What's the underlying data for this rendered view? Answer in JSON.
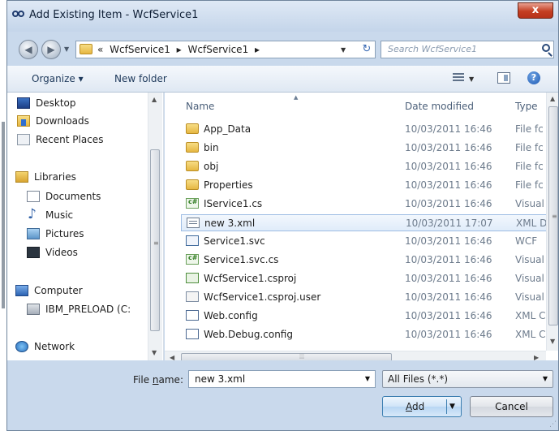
{
  "window": {
    "title": "Add Existing Item - WcfService1",
    "close_label": "x"
  },
  "address_bar": {
    "prefix": "«",
    "crumbs": [
      "WcfService1",
      "WcfService1"
    ],
    "separator": "▸",
    "search_placeholder": "Search WcfService1"
  },
  "toolbar": {
    "organize_label": "Organize ▾",
    "new_folder_label": "New folder",
    "help_label": "?"
  },
  "nav_pane": {
    "favorites": [
      {
        "label": "Desktop",
        "icon": "desktop-icon"
      },
      {
        "label": "Downloads",
        "icon": "downloads-folder-icon"
      },
      {
        "label": "Recent Places",
        "icon": "recent-places-icon"
      }
    ],
    "libraries": {
      "label": "Libraries",
      "items": [
        {
          "label": "Documents",
          "icon": "documents-icon"
        },
        {
          "label": "Music",
          "icon": "music-icon"
        },
        {
          "label": "Pictures",
          "icon": "pictures-icon"
        },
        {
          "label": "Videos",
          "icon": "videos-icon"
        }
      ]
    },
    "computer": {
      "label": "Computer",
      "drive_label": "IBM_PRELOAD (C:"
    },
    "network": {
      "label": "Network"
    }
  },
  "file_list": {
    "columns": {
      "name": "Name",
      "date": "Date modified",
      "type": "Type"
    },
    "rows": [
      {
        "name": "App_Data",
        "date": "10/03/2011 16:46",
        "type": "File fc",
        "icon": "folder-icon"
      },
      {
        "name": "bin",
        "date": "10/03/2011 16:46",
        "type": "File fc",
        "icon": "folder-icon"
      },
      {
        "name": "obj",
        "date": "10/03/2011 16:46",
        "type": "File fc",
        "icon": "folder-icon"
      },
      {
        "name": "Properties",
        "date": "10/03/2011 16:46",
        "type": "File fc",
        "icon": "folder-icon"
      },
      {
        "name": "IService1.cs",
        "date": "10/03/2011 16:46",
        "type": "Visual",
        "icon": "csharp-file-icon"
      },
      {
        "name": "new 3.xml",
        "date": "10/03/2011 17:07",
        "type": "XML D",
        "icon": "xml-file-icon",
        "selected": true
      },
      {
        "name": "Service1.svc",
        "date": "10/03/2011 16:46",
        "type": "WCF",
        "icon": "svc-file-icon"
      },
      {
        "name": "Service1.svc.cs",
        "date": "10/03/2011 16:46",
        "type": "Visual",
        "icon": "csharp-file-icon"
      },
      {
        "name": "WcfService1.csproj",
        "date": "10/03/2011 16:46",
        "type": "Visual",
        "icon": "csproj-file-icon"
      },
      {
        "name": "WcfService1.csproj.user",
        "date": "10/03/2011 16:46",
        "type": "Visual",
        "icon": "user-file-icon"
      },
      {
        "name": "Web.config",
        "date": "10/03/2011 16:46",
        "type": "XML C",
        "icon": "config-file-icon"
      },
      {
        "name": "Web.Debug.config",
        "date": "10/03/2011 16:46",
        "type": "XML C",
        "icon": "config-file-icon"
      }
    ]
  },
  "footer": {
    "file_name_label_prefix": "File ",
    "file_name_label_underlined": "n",
    "file_name_label_suffix": "ame:",
    "file_name_value": "new 3.xml",
    "file_type_value": "All Files (*.*)",
    "add_label_underlined": "A",
    "add_label_suffix": "dd",
    "cancel_label": "Cancel"
  }
}
